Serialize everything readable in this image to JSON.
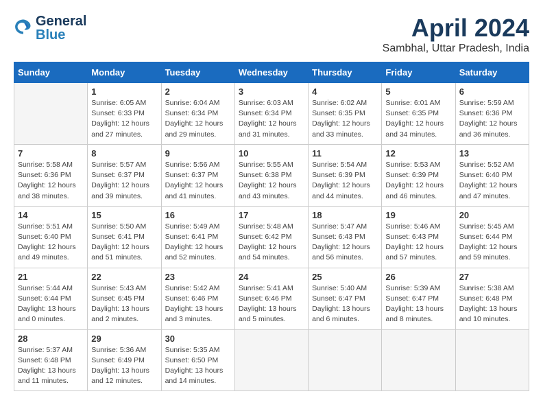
{
  "header": {
    "logo_general": "General",
    "logo_blue": "Blue",
    "month_year": "April 2024",
    "location": "Sambhal, Uttar Pradesh, India"
  },
  "days_of_week": [
    "Sunday",
    "Monday",
    "Tuesday",
    "Wednesday",
    "Thursday",
    "Friday",
    "Saturday"
  ],
  "weeks": [
    [
      {
        "day": "",
        "sunrise": "",
        "sunset": "",
        "daylight": "",
        "empty": true
      },
      {
        "day": "1",
        "sunrise": "Sunrise: 6:05 AM",
        "sunset": "Sunset: 6:33 PM",
        "daylight": "Daylight: 12 hours and 27 minutes."
      },
      {
        "day": "2",
        "sunrise": "Sunrise: 6:04 AM",
        "sunset": "Sunset: 6:34 PM",
        "daylight": "Daylight: 12 hours and 29 minutes."
      },
      {
        "day": "3",
        "sunrise": "Sunrise: 6:03 AM",
        "sunset": "Sunset: 6:34 PM",
        "daylight": "Daylight: 12 hours and 31 minutes."
      },
      {
        "day": "4",
        "sunrise": "Sunrise: 6:02 AM",
        "sunset": "Sunset: 6:35 PM",
        "daylight": "Daylight: 12 hours and 33 minutes."
      },
      {
        "day": "5",
        "sunrise": "Sunrise: 6:01 AM",
        "sunset": "Sunset: 6:35 PM",
        "daylight": "Daylight: 12 hours and 34 minutes."
      },
      {
        "day": "6",
        "sunrise": "Sunrise: 5:59 AM",
        "sunset": "Sunset: 6:36 PM",
        "daylight": "Daylight: 12 hours and 36 minutes."
      }
    ],
    [
      {
        "day": "7",
        "sunrise": "Sunrise: 5:58 AM",
        "sunset": "Sunset: 6:36 PM",
        "daylight": "Daylight: 12 hours and 38 minutes."
      },
      {
        "day": "8",
        "sunrise": "Sunrise: 5:57 AM",
        "sunset": "Sunset: 6:37 PM",
        "daylight": "Daylight: 12 hours and 39 minutes."
      },
      {
        "day": "9",
        "sunrise": "Sunrise: 5:56 AM",
        "sunset": "Sunset: 6:37 PM",
        "daylight": "Daylight: 12 hours and 41 minutes."
      },
      {
        "day": "10",
        "sunrise": "Sunrise: 5:55 AM",
        "sunset": "Sunset: 6:38 PM",
        "daylight": "Daylight: 12 hours and 43 minutes."
      },
      {
        "day": "11",
        "sunrise": "Sunrise: 5:54 AM",
        "sunset": "Sunset: 6:39 PM",
        "daylight": "Daylight: 12 hours and 44 minutes."
      },
      {
        "day": "12",
        "sunrise": "Sunrise: 5:53 AM",
        "sunset": "Sunset: 6:39 PM",
        "daylight": "Daylight: 12 hours and 46 minutes."
      },
      {
        "day": "13",
        "sunrise": "Sunrise: 5:52 AM",
        "sunset": "Sunset: 6:40 PM",
        "daylight": "Daylight: 12 hours and 47 minutes."
      }
    ],
    [
      {
        "day": "14",
        "sunrise": "Sunrise: 5:51 AM",
        "sunset": "Sunset: 6:40 PM",
        "daylight": "Daylight: 12 hours and 49 minutes."
      },
      {
        "day": "15",
        "sunrise": "Sunrise: 5:50 AM",
        "sunset": "Sunset: 6:41 PM",
        "daylight": "Daylight: 12 hours and 51 minutes."
      },
      {
        "day": "16",
        "sunrise": "Sunrise: 5:49 AM",
        "sunset": "Sunset: 6:41 PM",
        "daylight": "Daylight: 12 hours and 52 minutes."
      },
      {
        "day": "17",
        "sunrise": "Sunrise: 5:48 AM",
        "sunset": "Sunset: 6:42 PM",
        "daylight": "Daylight: 12 hours and 54 minutes."
      },
      {
        "day": "18",
        "sunrise": "Sunrise: 5:47 AM",
        "sunset": "Sunset: 6:43 PM",
        "daylight": "Daylight: 12 hours and 56 minutes."
      },
      {
        "day": "19",
        "sunrise": "Sunrise: 5:46 AM",
        "sunset": "Sunset: 6:43 PM",
        "daylight": "Daylight: 12 hours and 57 minutes."
      },
      {
        "day": "20",
        "sunrise": "Sunrise: 5:45 AM",
        "sunset": "Sunset: 6:44 PM",
        "daylight": "Daylight: 12 hours and 59 minutes."
      }
    ],
    [
      {
        "day": "21",
        "sunrise": "Sunrise: 5:44 AM",
        "sunset": "Sunset: 6:44 PM",
        "daylight": "Daylight: 13 hours and 0 minutes."
      },
      {
        "day": "22",
        "sunrise": "Sunrise: 5:43 AM",
        "sunset": "Sunset: 6:45 PM",
        "daylight": "Daylight: 13 hours and 2 minutes."
      },
      {
        "day": "23",
        "sunrise": "Sunrise: 5:42 AM",
        "sunset": "Sunset: 6:46 PM",
        "daylight": "Daylight: 13 hours and 3 minutes."
      },
      {
        "day": "24",
        "sunrise": "Sunrise: 5:41 AM",
        "sunset": "Sunset: 6:46 PM",
        "daylight": "Daylight: 13 hours and 5 minutes."
      },
      {
        "day": "25",
        "sunrise": "Sunrise: 5:40 AM",
        "sunset": "Sunset: 6:47 PM",
        "daylight": "Daylight: 13 hours and 6 minutes."
      },
      {
        "day": "26",
        "sunrise": "Sunrise: 5:39 AM",
        "sunset": "Sunset: 6:47 PM",
        "daylight": "Daylight: 13 hours and 8 minutes."
      },
      {
        "day": "27",
        "sunrise": "Sunrise: 5:38 AM",
        "sunset": "Sunset: 6:48 PM",
        "daylight": "Daylight: 13 hours and 10 minutes."
      }
    ],
    [
      {
        "day": "28",
        "sunrise": "Sunrise: 5:37 AM",
        "sunset": "Sunset: 6:48 PM",
        "daylight": "Daylight: 13 hours and 11 minutes."
      },
      {
        "day": "29",
        "sunrise": "Sunrise: 5:36 AM",
        "sunset": "Sunset: 6:49 PM",
        "daylight": "Daylight: 13 hours and 12 minutes."
      },
      {
        "day": "30",
        "sunrise": "Sunrise: 5:35 AM",
        "sunset": "Sunset: 6:50 PM",
        "daylight": "Daylight: 13 hours and 14 minutes."
      },
      {
        "day": "",
        "sunrise": "",
        "sunset": "",
        "daylight": "",
        "empty": true
      },
      {
        "day": "",
        "sunrise": "",
        "sunset": "",
        "daylight": "",
        "empty": true
      },
      {
        "day": "",
        "sunrise": "",
        "sunset": "",
        "daylight": "",
        "empty": true
      },
      {
        "day": "",
        "sunrise": "",
        "sunset": "",
        "daylight": "",
        "empty": true
      }
    ]
  ]
}
